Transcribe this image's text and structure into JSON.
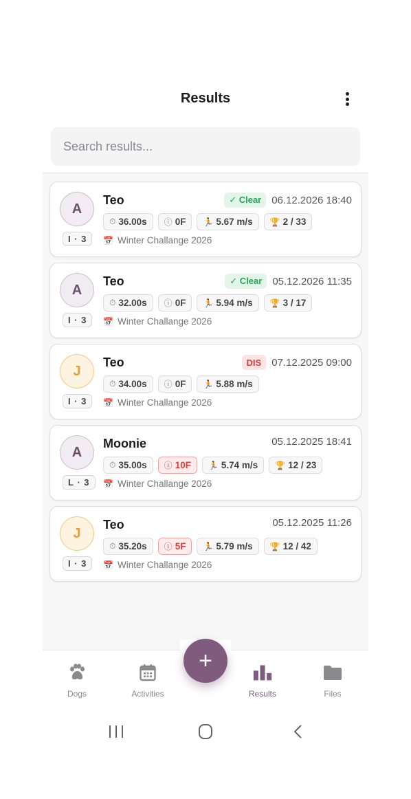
{
  "header": {
    "title": "Results",
    "menu_icon": "more-vertical-icon"
  },
  "search": {
    "placeholder": "Search results..."
  },
  "results": [
    {
      "avatar": "A",
      "level": "I · 3",
      "name": "Teo",
      "status": "✓ Clear",
      "date": "06.12.2026 18:40",
      "time": "36.00s",
      "faults": "0F",
      "speed": "5.67 m/s",
      "placement": "2 / 33",
      "event": "Winter Challange 2026"
    },
    {
      "avatar": "A",
      "level": "I · 3",
      "name": "Teo",
      "status": "✓ Clear",
      "date": "05.12.2026 11:35",
      "time": "32.00s",
      "faults": "0F",
      "speed": "5.94 m/s",
      "placement": "3 / 17",
      "event": "Winter Challange 2026"
    },
    {
      "avatar": "J",
      "level": "I · 3",
      "name": "Teo",
      "status": "DIS",
      "date": "07.12.2025 09:00",
      "time": "34.00s",
      "faults": "0F",
      "speed": "5.88 m/s",
      "event": "Winter Challange 2026"
    },
    {
      "avatar": "A",
      "level": "L · 3",
      "name": "Moonie",
      "date": "05.12.2025 18:41",
      "time": "35.00s",
      "faults": "10F",
      "speed": "5.74 m/s",
      "placement": "12 / 23",
      "event": "Winter Challange 2026"
    },
    {
      "avatar": "J",
      "level": "I · 3",
      "name": "Teo",
      "date": "05.12.2025 11:26",
      "time": "35.20s",
      "faults": "5F",
      "speed": "5.79 m/s",
      "placement": "12 / 42",
      "event": "Winter Challange 2026"
    }
  ],
  "fab": {
    "label": "+"
  },
  "nav": {
    "dogs": "Dogs",
    "activities": "Activities",
    "results": "Results",
    "files": "Files"
  },
  "colors": {
    "accent": "#7f5c7e",
    "clear": "#28a55a",
    "error": "#e03b3b",
    "avatar_orange": "#e8a030"
  }
}
